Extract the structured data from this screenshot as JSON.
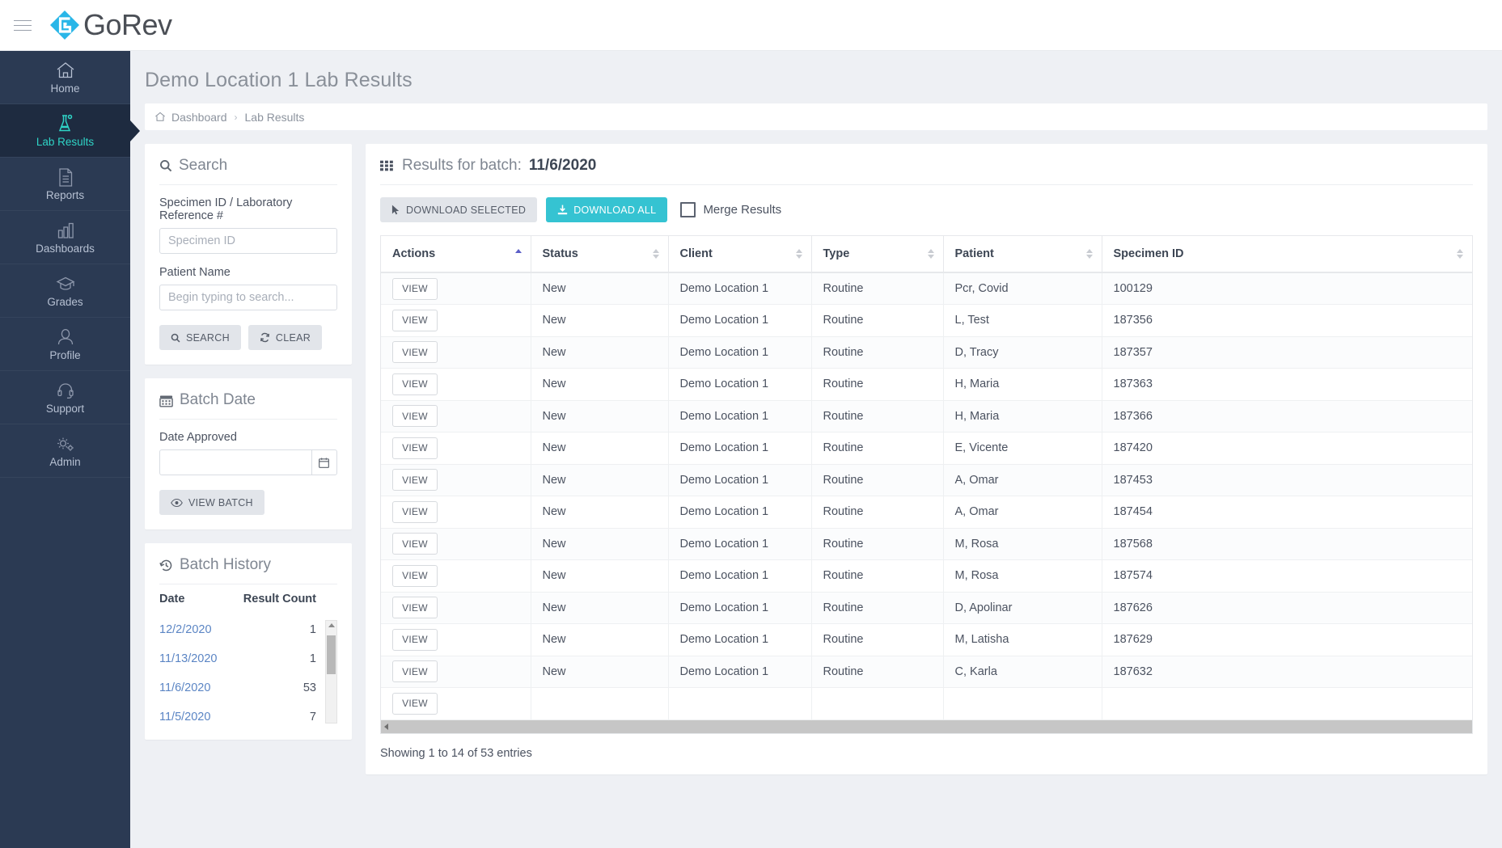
{
  "topbar": {
    "menu_icon": "hamburger-icon",
    "brand": "GoRev"
  },
  "sidebar": {
    "items": [
      {
        "label": "Home",
        "icon": "home-icon",
        "active": false
      },
      {
        "label": "Lab Results",
        "icon": "flask-icon",
        "active": true
      },
      {
        "label": "Reports",
        "icon": "document-icon",
        "active": false
      },
      {
        "label": "Dashboards",
        "icon": "bar-chart-icon",
        "active": false
      },
      {
        "label": "Grades",
        "icon": "graduation-cap-icon",
        "active": false
      },
      {
        "label": "Profile",
        "icon": "user-icon",
        "active": false
      },
      {
        "label": "Support",
        "icon": "headset-icon",
        "active": false
      },
      {
        "label": "Admin",
        "icon": "gears-icon",
        "active": false
      }
    ]
  },
  "page": {
    "title": "Demo Location 1 Lab Results",
    "breadcrumb": {
      "home_icon": "home-icon",
      "items": [
        "Dashboard",
        "Lab Results"
      ],
      "separator": "›"
    }
  },
  "search_panel": {
    "title": "Search",
    "icon": "search-icon",
    "specimen_label": "Specimen ID / Laboratory Reference #",
    "specimen_value": "",
    "specimen_placeholder": "Specimen ID",
    "patient_label": "Patient Name",
    "patient_value": "",
    "patient_placeholder": "Begin typing to search...",
    "search_button": "SEARCH",
    "clear_button": "CLEAR"
  },
  "batch_date_panel": {
    "title": "Batch Date",
    "icon": "calendar-icon",
    "date_label": "Date Approved",
    "date_value": "",
    "date_placeholder": "",
    "calendar_button_icon": "calendar-icon",
    "view_batch_button": "VIEW BATCH",
    "view_batch_icon": "eye-icon"
  },
  "batch_history_panel": {
    "title": "Batch History",
    "icon": "history-icon",
    "columns": [
      "Date",
      "Result Count"
    ],
    "rows": [
      {
        "date": "12/2/2020",
        "count": "1"
      },
      {
        "date": "11/13/2020",
        "count": "1"
      },
      {
        "date": "11/6/2020",
        "count": "53"
      },
      {
        "date": "11/5/2020",
        "count": "7"
      }
    ]
  },
  "results": {
    "heading_prefix": "Results for batch:",
    "heading_batch": "11/6/2020",
    "heading_icon": "grid-icon",
    "toolbar": {
      "download_selected": "DOWNLOAD SELECTED",
      "download_selected_icon": "cursor-icon",
      "download_all": "DOWNLOAD ALL",
      "download_all_icon": "download-icon",
      "merge_label": "Merge Results",
      "merge_checked": false
    },
    "columns": [
      {
        "label": "Actions",
        "sort": "asc"
      },
      {
        "label": "Status",
        "sort": "none"
      },
      {
        "label": "Client",
        "sort": "none"
      },
      {
        "label": "Type",
        "sort": "none"
      },
      {
        "label": "Patient",
        "sort": "none"
      },
      {
        "label": "Specimen ID",
        "sort": "none"
      }
    ],
    "action_label": "VIEW",
    "rows": [
      {
        "action": "VIEW",
        "status": "New",
        "client": "Demo Location 1",
        "type": "Routine",
        "patient": "Pcr, Covid",
        "specimen": "100129"
      },
      {
        "action": "VIEW",
        "status": "New",
        "client": "Demo Location 1",
        "type": "Routine",
        "patient": "L, Test",
        "specimen": "187356"
      },
      {
        "action": "VIEW",
        "status": "New",
        "client": "Demo Location 1",
        "type": "Routine",
        "patient": "D, Tracy",
        "specimen": "187357"
      },
      {
        "action": "VIEW",
        "status": "New",
        "client": "Demo Location 1",
        "type": "Routine",
        "patient": "H, Maria",
        "specimen": "187363"
      },
      {
        "action": "VIEW",
        "status": "New",
        "client": "Demo Location 1",
        "type": "Routine",
        "patient": "H, Maria",
        "specimen": "187366"
      },
      {
        "action": "VIEW",
        "status": "New",
        "client": "Demo Location 1",
        "type": "Routine",
        "patient": "E, Vicente",
        "specimen": "187420"
      },
      {
        "action": "VIEW",
        "status": "New",
        "client": "Demo Location 1",
        "type": "Routine",
        "patient": "A, Omar",
        "specimen": "187453"
      },
      {
        "action": "VIEW",
        "status": "New",
        "client": "Demo Location 1",
        "type": "Routine",
        "patient": "A, Omar",
        "specimen": "187454"
      },
      {
        "action": "VIEW",
        "status": "New",
        "client": "Demo Location 1",
        "type": "Routine",
        "patient": "M, Rosa",
        "specimen": "187568"
      },
      {
        "action": "VIEW",
        "status": "New",
        "client": "Demo Location 1",
        "type": "Routine",
        "patient": "M, Rosa",
        "specimen": "187574"
      },
      {
        "action": "VIEW",
        "status": "New",
        "client": "Demo Location 1",
        "type": "Routine",
        "patient": "D, Apolinar",
        "specimen": "187626"
      },
      {
        "action": "VIEW",
        "status": "New",
        "client": "Demo Location 1",
        "type": "Routine",
        "patient": "M, Latisha",
        "specimen": "187629"
      },
      {
        "action": "VIEW",
        "status": "New",
        "client": "Demo Location 1",
        "type": "Routine",
        "patient": "C, Karla",
        "specimen": "187632"
      },
      {
        "action": "VIEW",
        "status": "",
        "client": "",
        "type": "",
        "patient": "",
        "specimen": ""
      }
    ],
    "footer": "Showing 1 to 14 of 53 entries"
  },
  "colors": {
    "sidebar_bg": "#2b3a53",
    "sidebar_active_bg": "#1e2b40",
    "accent_teal": "#35c3d2",
    "active_label": "#2fd4c6",
    "logo_blue": "#29b6e8",
    "sort_active": "#5b5fc7"
  }
}
